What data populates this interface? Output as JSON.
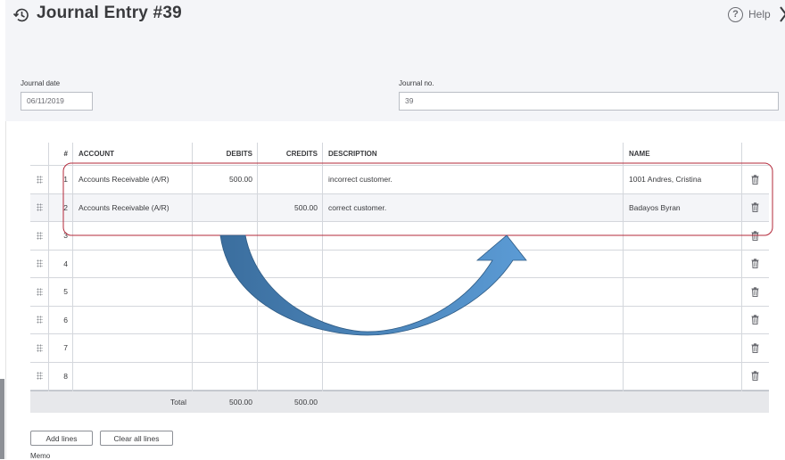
{
  "header": {
    "title": "Journal Entry #39",
    "help_label": "Help",
    "help_glyph": "?"
  },
  "form": {
    "journal_date_label": "Journal date",
    "journal_date_value": "06/11/2019",
    "journal_no_label": "Journal no.",
    "journal_no_value": "39"
  },
  "table": {
    "columns": [
      "#",
      "ACCOUNT",
      "DEBITS",
      "CREDITS",
      "DESCRIPTION",
      "NAME"
    ],
    "rows": [
      {
        "num": "1",
        "account": "Accounts Receivable (A/R)",
        "debits": "500.00",
        "credits": "",
        "description": "incorrect customer.",
        "name": "1001 Andres, Cristina"
      },
      {
        "num": "2",
        "account": "Accounts Receivable (A/R)",
        "debits": "",
        "credits": "500.00",
        "description": "correct customer.",
        "name": "Badayos Byran"
      },
      {
        "num": "3",
        "account": "",
        "debits": "",
        "credits": "",
        "description": "",
        "name": ""
      },
      {
        "num": "4",
        "account": "",
        "debits": "",
        "credits": "",
        "description": "",
        "name": ""
      },
      {
        "num": "5",
        "account": "",
        "debits": "",
        "credits": "",
        "description": "",
        "name": ""
      },
      {
        "num": "6",
        "account": "",
        "debits": "",
        "credits": "",
        "description": "",
        "name": ""
      },
      {
        "num": "7",
        "account": "",
        "debits": "",
        "credits": "",
        "description": "",
        "name": ""
      },
      {
        "num": "8",
        "account": "",
        "debits": "",
        "credits": "",
        "description": "",
        "name": ""
      }
    ],
    "total_label": "Total",
    "total_debits": "500.00",
    "total_credits": "500.00"
  },
  "buttons": {
    "add_lines": "Add lines",
    "clear_all_lines": "Clear all lines"
  },
  "memo_label": "Memo",
  "colors": {
    "highlight_outline": "#b3283a",
    "arrow_dark": "#3b6e9e",
    "arrow_light": "#5b9bd5",
    "header_bg": "#f4f5f8"
  },
  "icons": [
    "history-icon",
    "help-icon",
    "close-icon",
    "drag-handle-icon",
    "trash-icon"
  ]
}
